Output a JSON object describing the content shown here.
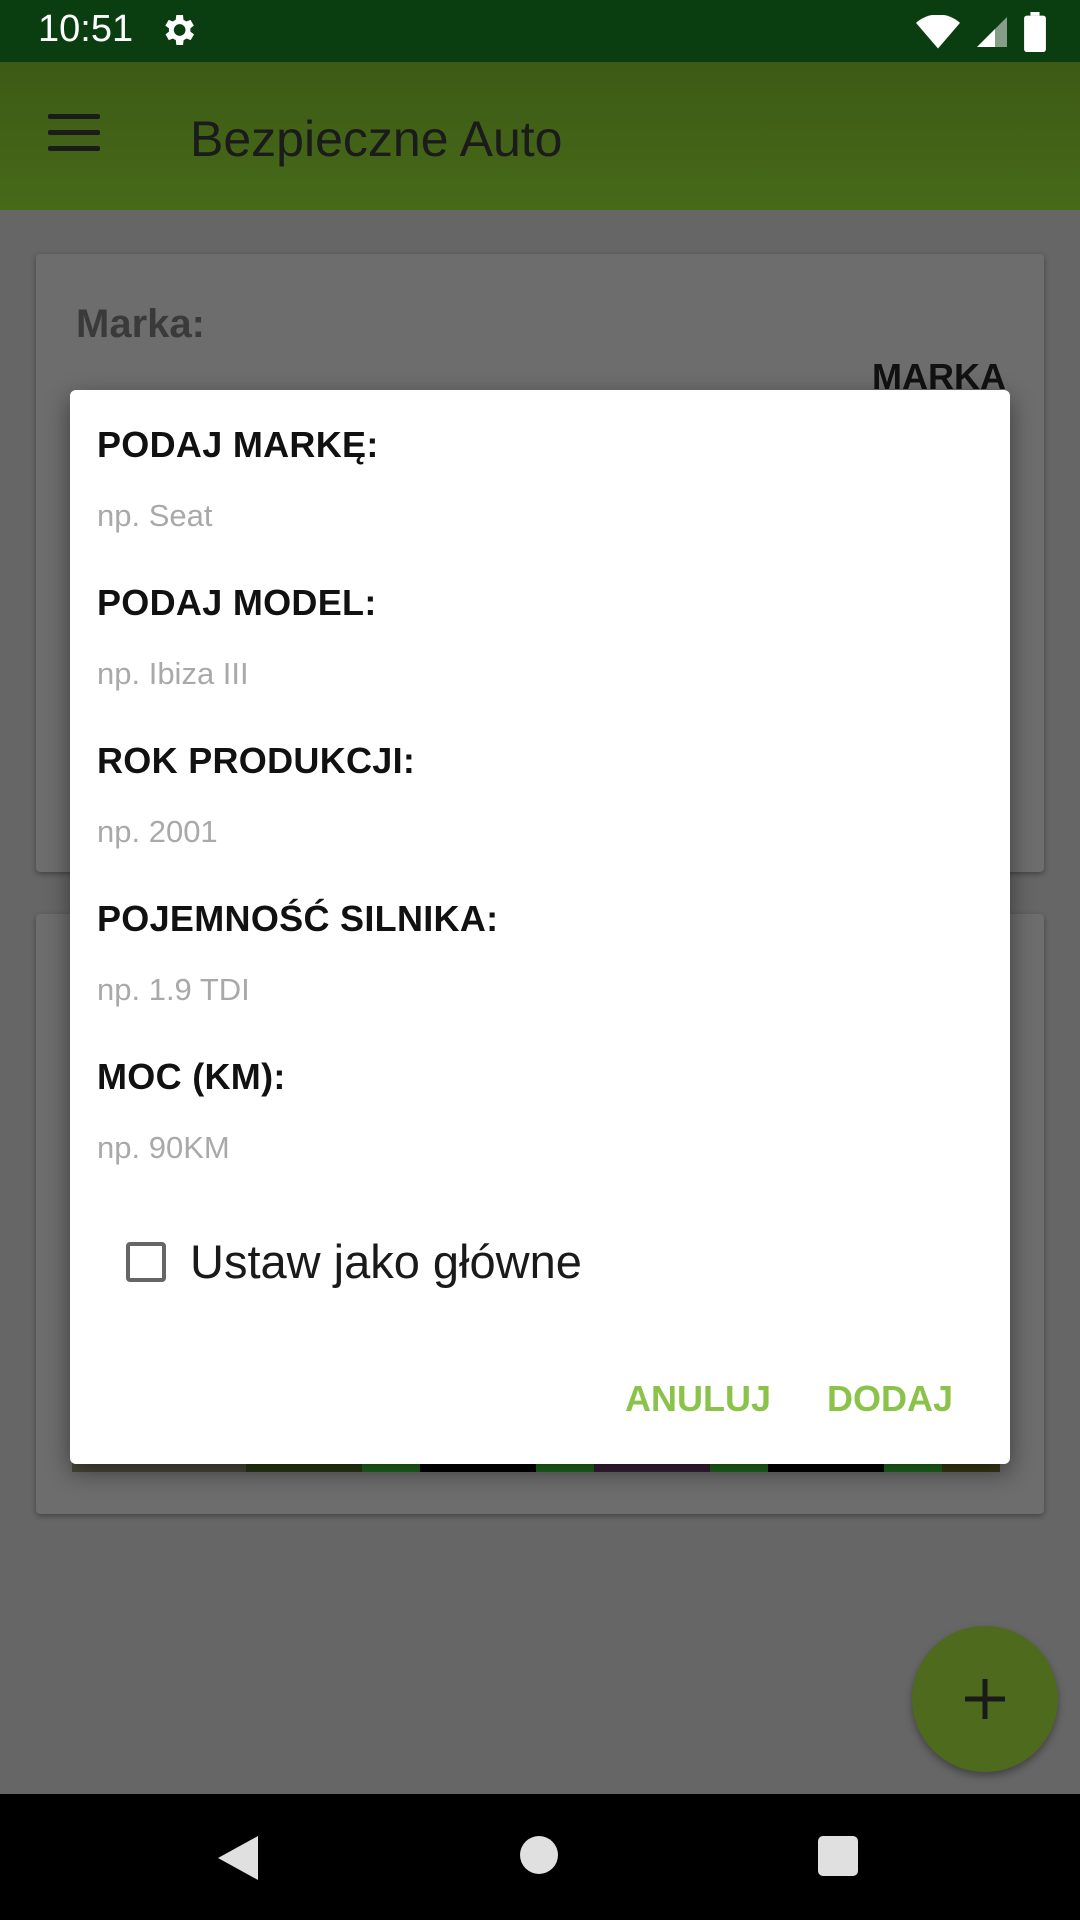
{
  "status_bar": {
    "time": "10:51"
  },
  "app_bar": {
    "title": "Bezpieczne Auto"
  },
  "background_card": {
    "label": "Marka:",
    "value": "MARKA"
  },
  "dialog": {
    "fields": [
      {
        "label": "PODAJ MARKĘ:",
        "placeholder": "np. Seat",
        "value": ""
      },
      {
        "label": "PODAJ MODEL:",
        "placeholder": "np. Ibiza III",
        "value": ""
      },
      {
        "label": "ROK PRODUKCJI:",
        "placeholder": "np. 2001",
        "value": ""
      },
      {
        "label": "POJEMNOŚĆ SILNIKA:",
        "placeholder": "np. 1.9 TDI",
        "value": ""
      },
      {
        "label": "MOC (KM):",
        "placeholder": "np. 90KM",
        "value": ""
      }
    ],
    "checkbox": {
      "label": "Ustaw jako główne",
      "checked": false
    },
    "buttons": {
      "cancel": "ANULUJ",
      "confirm": "DODAJ"
    }
  },
  "colors": {
    "accent": "#8bc34a",
    "status_bar": "#0a3d10",
    "app_bar": "#466a18",
    "fab": "#4d6a1d"
  },
  "icons": [
    "settings-icon",
    "wifi-icon",
    "signal-icon",
    "battery-icon",
    "menu-icon",
    "add-icon",
    "back-icon",
    "home-icon",
    "recents-icon"
  ]
}
